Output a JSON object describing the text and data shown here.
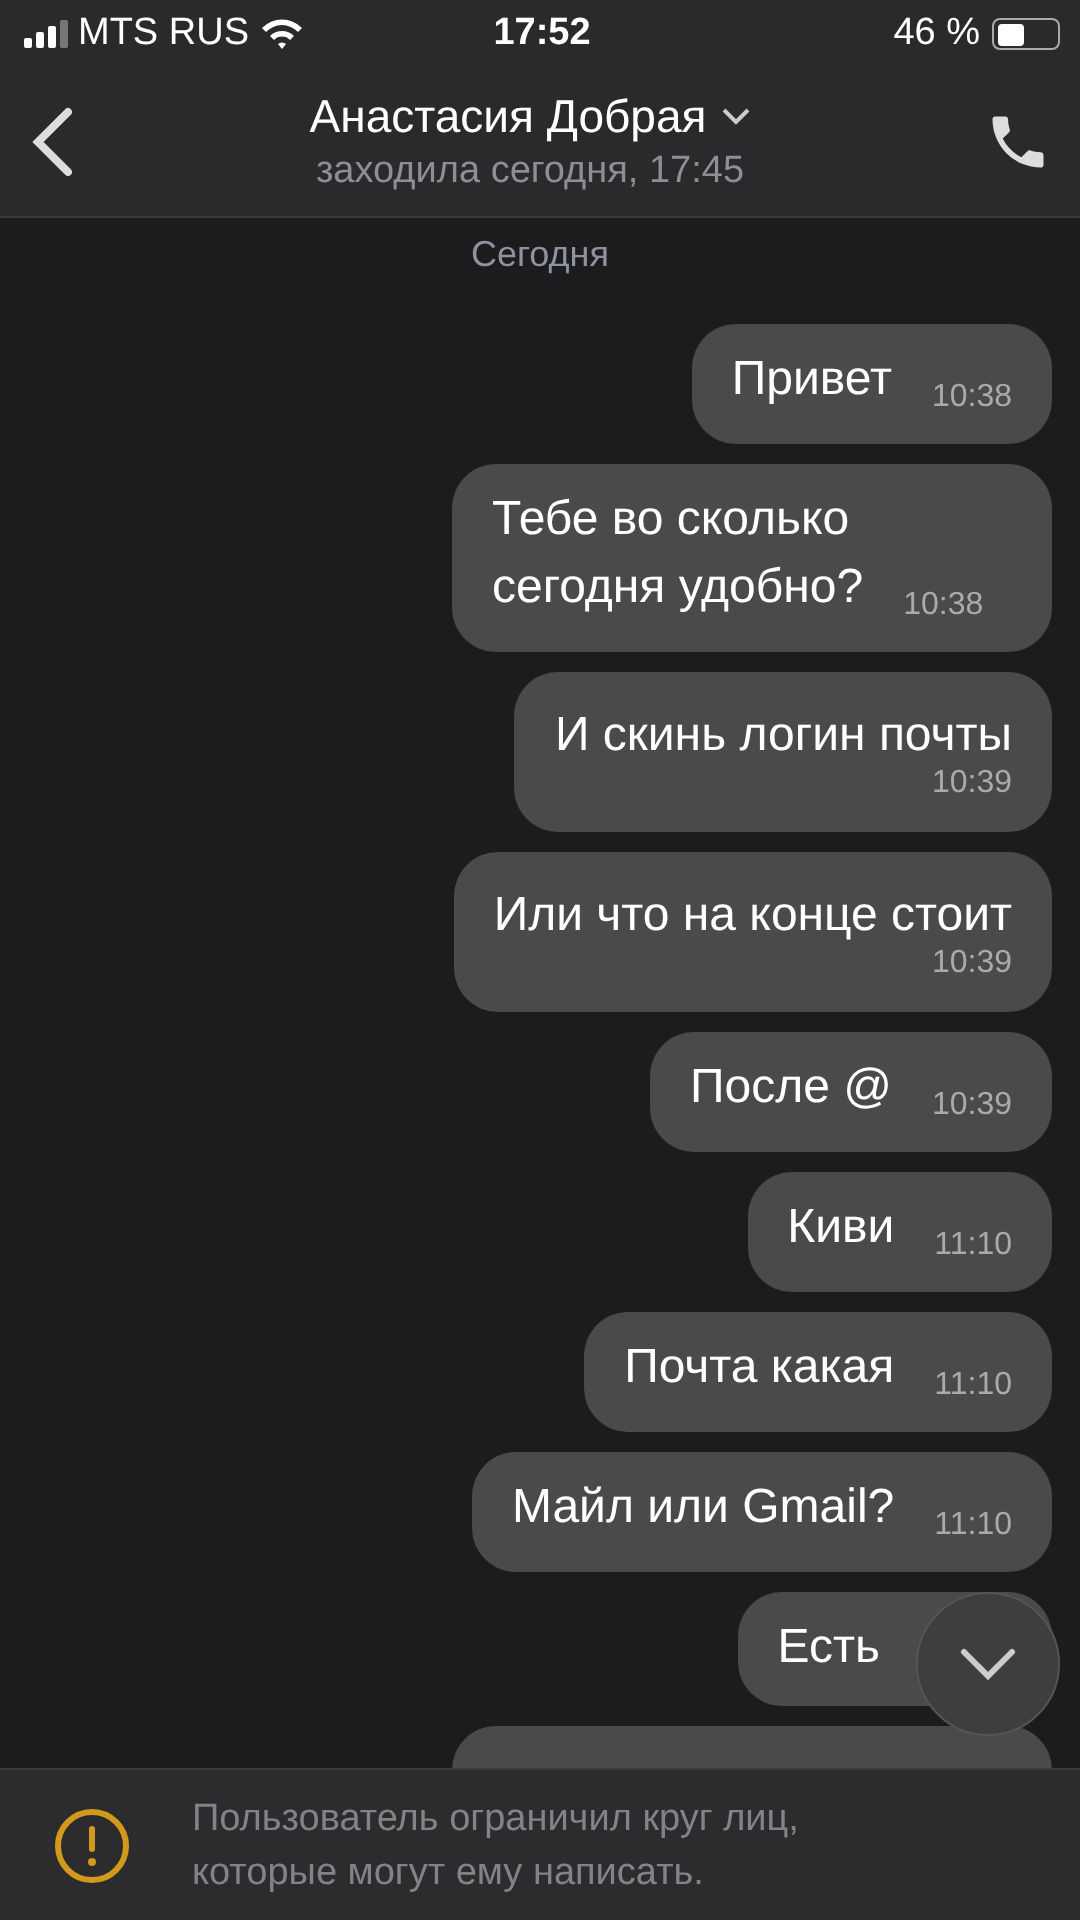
{
  "status_bar": {
    "carrier": "MTS RUS",
    "time": "17:52",
    "battery": "46 %"
  },
  "header": {
    "name": "Анастасия Добрая",
    "status": "заходила сегодня, 17:45"
  },
  "date_separator": "Сегодня",
  "messages": [
    {
      "text": "Привет",
      "time": "10:38",
      "kind": "inline"
    },
    {
      "text": "Тебе во сколько сегодня удобно?",
      "time": "10:38",
      "kind": "inline"
    },
    {
      "text": "И скинь логин почты",
      "time": "10:39",
      "kind": "below"
    },
    {
      "text": "Или что на конце стоит",
      "time": "10:39",
      "kind": "below"
    },
    {
      "text": "После @",
      "time": "10:39",
      "kind": "inline"
    },
    {
      "text": "Киви",
      "time": "11:10",
      "kind": "inline"
    },
    {
      "text": "Почта какая",
      "time": "11:10",
      "kind": "inline"
    },
    {
      "text": "Майл или Gmail?",
      "time": "11:10",
      "kind": "inline"
    },
    {
      "text": "Есть",
      "kind": "notime"
    },
    {
      "kind": "hidden"
    }
  ],
  "banner": {
    "text": "Пользователь ограничил круг лиц, которые могут ему написать."
  }
}
